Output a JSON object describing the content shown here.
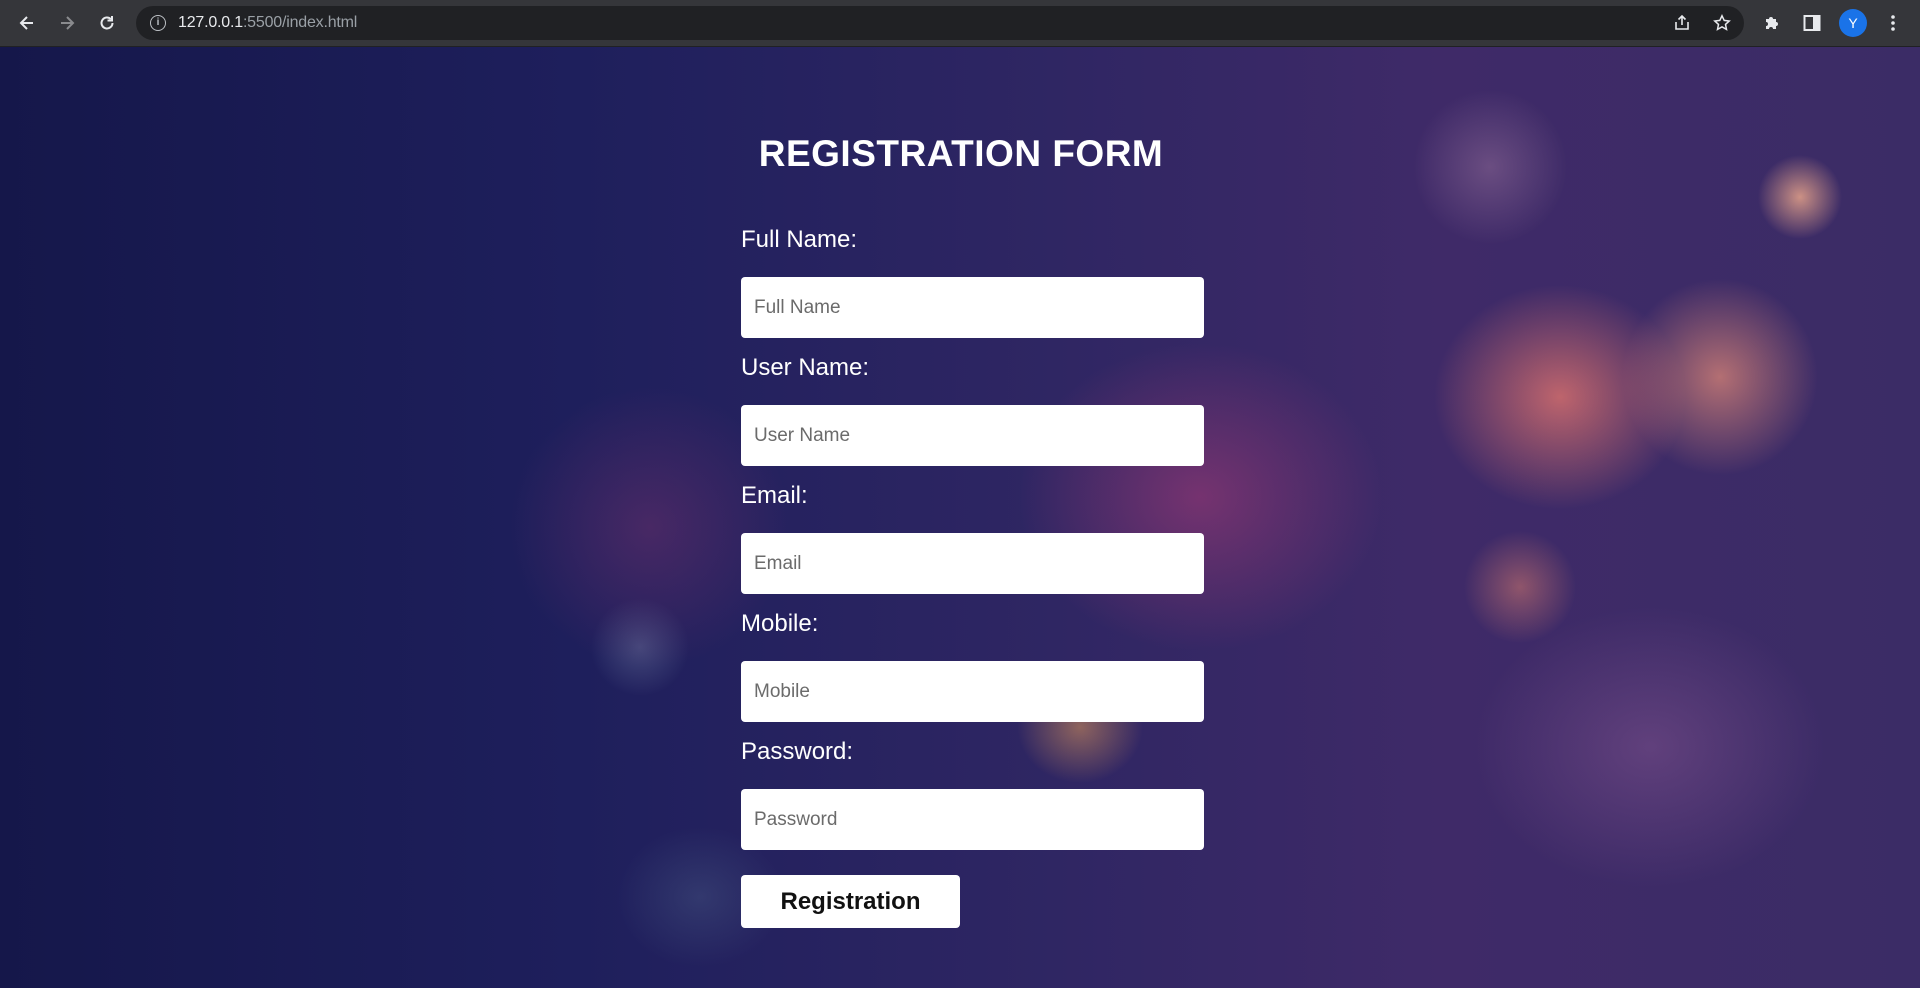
{
  "browser": {
    "url_host": "127.0.0.1",
    "url_rest": ":5500/index.html",
    "profile_initial": "Y",
    "avatar_color": "#1a73e8"
  },
  "icons": {
    "back": "arrow-left",
    "forward": "arrow-right",
    "reload": "reload",
    "site_info": "info",
    "share": "share",
    "bookmark": "star",
    "extensions": "puzzle",
    "side_panel": "side-panel",
    "menu": "three-dots-vertical"
  },
  "form": {
    "title": "REGISTRATION FORM",
    "fields": [
      {
        "label": "Full Name:",
        "placeholder": "Full Name",
        "value": ""
      },
      {
        "label": "User Name:",
        "placeholder": "User Name",
        "value": ""
      },
      {
        "label": "Email:",
        "placeholder": "Email",
        "value": ""
      },
      {
        "label": "Mobile:",
        "placeholder": "Mobile",
        "value": ""
      },
      {
        "label": "Password:",
        "placeholder": "Password",
        "value": ""
      }
    ],
    "submit_label": "Registration"
  },
  "colors": {
    "browser_bar": "#35363a",
    "omnibox": "#202124",
    "text_on_background": "#ffffff",
    "input_background": "#ffffff"
  }
}
